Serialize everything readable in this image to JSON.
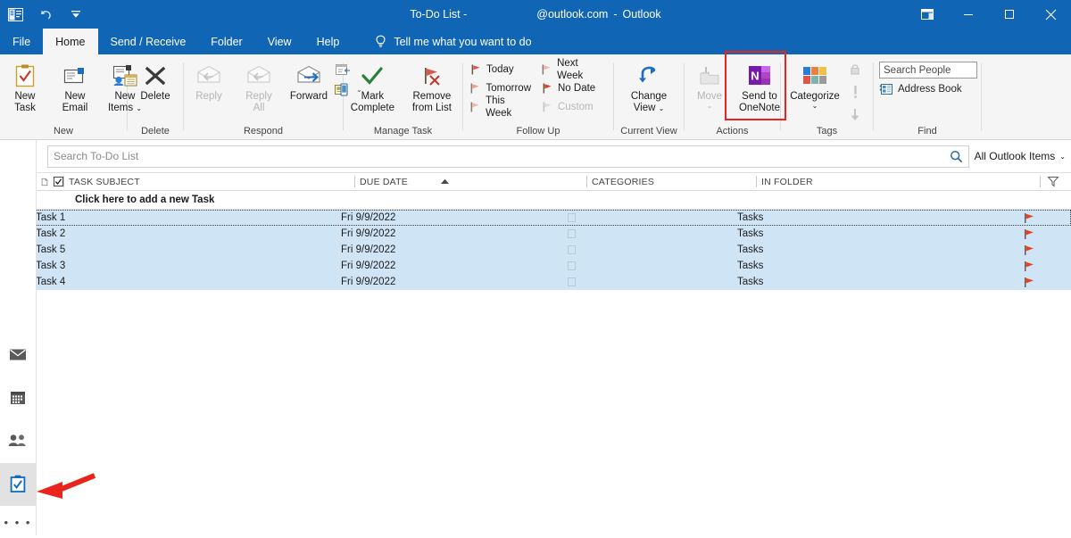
{
  "window": {
    "title_segment_1": "To-Do List -",
    "title_segment_2": "@outlook.com",
    "title_dash": "-",
    "title_app": "Outlook",
    "quick_access": [
      {
        "name": "outlook-quick-icon",
        "label": "Outlook"
      },
      {
        "name": "undo-icon",
        "label": "Undo"
      },
      {
        "name": "customize-qat-icon",
        "label": "Customize Quick Access Toolbar"
      }
    ],
    "controls": [
      {
        "name": "ribbon-display-options",
        "label": "Ribbon Display Options"
      },
      {
        "name": "minimize-button",
        "label": "Minimize"
      },
      {
        "name": "maximize-button",
        "label": "Maximize"
      },
      {
        "name": "close-button",
        "label": "Close"
      }
    ]
  },
  "tabs": [
    {
      "label": "File",
      "active": false
    },
    {
      "label": "Home",
      "active": true
    },
    {
      "label": "Send / Receive",
      "active": false
    },
    {
      "label": "Folder",
      "active": false
    },
    {
      "label": "View",
      "active": false
    },
    {
      "label": "Help",
      "active": false
    }
  ],
  "tell_me": "Tell me what you want to do",
  "ribbon": {
    "new": {
      "group_label": "New",
      "new_task": {
        "line1": "New",
        "line2": "Task"
      },
      "new_email": {
        "line1": "New",
        "line2": "Email"
      },
      "new_items": {
        "line1": "New",
        "line2": "Items"
      }
    },
    "delete": {
      "group_label": "Delete",
      "delete": "Delete"
    },
    "respond": {
      "group_label": "Respond",
      "reply": "Reply",
      "reply_all_line1": "Reply",
      "reply_all_line2": "All",
      "forward": "Forward"
    },
    "manage_task": {
      "group_label": "Manage Task",
      "mark_complete_line1": "Mark",
      "mark_complete_line2": "Complete",
      "remove_line1": "Remove",
      "remove_line2": "from List"
    },
    "follow_up": {
      "group_label": "Follow Up",
      "items": [
        {
          "label": "Today",
          "disabled": false
        },
        {
          "label": "Next Week",
          "disabled": false
        },
        {
          "label": "Tomorrow",
          "disabled": false
        },
        {
          "label": "No Date",
          "disabled": false
        },
        {
          "label": "This Week",
          "disabled": false
        },
        {
          "label": "Custom",
          "disabled": true
        }
      ]
    },
    "current_view": {
      "group_label": "Current View",
      "change_view_line1": "Change",
      "change_view_line2": "View"
    },
    "actions": {
      "group_label": "Actions",
      "move": "Move",
      "send_to_onenote_line1": "Send to",
      "send_to_onenote_line2": "OneNote",
      "highlight_color": "#e8241d"
    },
    "tags": {
      "group_label": "Tags",
      "categorize": "Categorize",
      "icons": [
        {
          "name": "private-lock-icon",
          "label": "Private"
        },
        {
          "name": "high-importance-icon",
          "label": "High Importance"
        },
        {
          "name": "low-importance-icon",
          "label": "Low Importance"
        }
      ]
    },
    "find": {
      "group_label": "Find",
      "search_people_placeholder": "Search People",
      "address_book": "Address Book"
    }
  },
  "search_bar": {
    "placeholder": "Search To-Do List",
    "value": "",
    "scope": "All Outlook Items"
  },
  "list": {
    "add_new_row": "Click here to add a new Task",
    "columns": [
      {
        "key": "icon",
        "label": ""
      },
      {
        "key": "complete",
        "label": ""
      },
      {
        "key": "subject",
        "label": "TASK SUBJECT"
      },
      {
        "key": "due_date",
        "label": "DUE DATE",
        "sort": "ascending"
      },
      {
        "key": "categories",
        "label": "CATEGORIES"
      },
      {
        "key": "in_folder",
        "label": "IN FOLDER"
      }
    ],
    "rows": [
      {
        "subject": "Task 1",
        "due_date": "Fri 9/9/2022",
        "categories": "",
        "in_folder": "Tasks",
        "selected": true,
        "focused": true,
        "flagged": true
      },
      {
        "subject": "Task 2",
        "due_date": "Fri 9/9/2022",
        "categories": "",
        "in_folder": "Tasks",
        "selected": true,
        "focused": false,
        "flagged": true
      },
      {
        "subject": "Task 5",
        "due_date": "Fri 9/9/2022",
        "categories": "",
        "in_folder": "Tasks",
        "selected": true,
        "focused": false,
        "flagged": true
      },
      {
        "subject": "Task 3",
        "due_date": "Fri 9/9/2022",
        "categories": "",
        "in_folder": "Tasks",
        "selected": true,
        "focused": false,
        "flagged": true
      },
      {
        "subject": "Task 4",
        "due_date": "Fri 9/9/2022",
        "categories": "",
        "in_folder": "Tasks",
        "selected": true,
        "focused": false,
        "flagged": true
      }
    ]
  },
  "nav_rail": {
    "items": [
      {
        "name": "mail",
        "label": "Mail",
        "selected": false
      },
      {
        "name": "calendar",
        "label": "Calendar",
        "selected": false
      },
      {
        "name": "people",
        "label": "People",
        "selected": false
      },
      {
        "name": "tasks",
        "label": "Tasks",
        "selected": true
      }
    ],
    "more": "• • •"
  },
  "annotation": {
    "arrow_color": "#e8241d",
    "points_to": "tasks"
  }
}
